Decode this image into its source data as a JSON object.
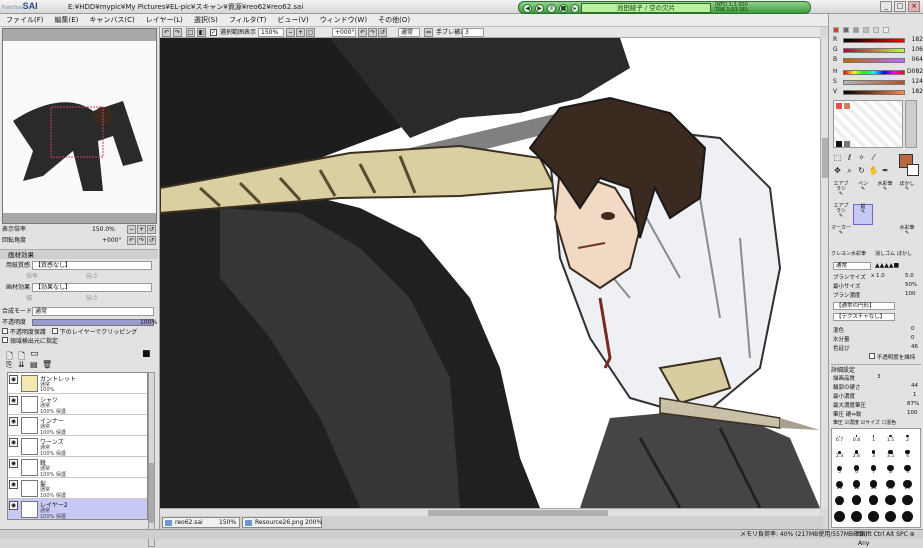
{
  "app": {
    "logo": "SAI",
    "logo_prefix": "PaintTool",
    "title": "E:¥HDD¥mypic¥My Pictures¥EL-pic¥スキャン¥資源¥reo62¥reo62.sai"
  },
  "player": {
    "lcd": "池田綾子 / 空の欠片",
    "info_line1": "INFO 1:3 000",
    "info_line2": "TRK 1:03 SEL"
  },
  "window": {
    "min": "_",
    "max": "□",
    "close": "×"
  },
  "menu": [
    "ファイル(F)",
    "編集(E)",
    "キャンバス(C)",
    "レイヤー(L)",
    "選択(S)",
    "フィルタ(T)",
    "ビュー(V)",
    "ウィンドウ(W)",
    "その他(O)"
  ],
  "navigator": {
    "zoom_label": "表示倍率",
    "zoom_value": "150.0%",
    "angle_label": "回転角度",
    "angle_value": "+000°"
  },
  "paper": {
    "header": "画材効果",
    "texture_label": "用紙質感",
    "texture_value": "【質感なし】",
    "texture_sub1": "倍率",
    "texture_sub2": "強さ",
    "effect_label": "画材効果",
    "effect_value": "【効果なし】",
    "effect_sub1": "幅",
    "effect_sub2": "強さ"
  },
  "layer_props": {
    "blend_label": "合成モード",
    "blend_value": "通常",
    "opacity_label": "不透明度",
    "opacity_value": "100%",
    "protect_label": "不透明度保護",
    "clip_label": "下のレイヤーでクリッピング",
    "select_source_label": "領域検出元に指定"
  },
  "layers": [
    {
      "name": "ガントレット",
      "mode": "通常",
      "opacity": "100%",
      "selected": false
    },
    {
      "name": "シャツ",
      "mode": "通常",
      "opacity": "100% 保護",
      "selected": false
    },
    {
      "name": "インナー",
      "mode": "通常",
      "opacity": "100% 保護",
      "selected": false
    },
    {
      "name": "ワーンズ",
      "mode": "通常",
      "opacity": "100% 保護",
      "selected": false
    },
    {
      "name": "靴",
      "mode": "通常",
      "opacity": "100% 保護",
      "selected": false
    },
    {
      "name": "髪",
      "mode": "通常",
      "opacity": "100% 保護",
      "selected": false
    },
    {
      "name": "レイヤー2",
      "mode": "通常",
      "opacity": "100% 保護",
      "selected": true
    }
  ],
  "canvasbar": {
    "show_selection_label": "選択範囲表示",
    "zoom": "150%",
    "angle": "+000°",
    "mode": "通常",
    "stabilizer_label": "手ブレ補正",
    "stabilizer_value": "3"
  },
  "tabs": [
    {
      "name": "reo62.sai",
      "zoom": "150%"
    },
    {
      "name": "Resource26.png",
      "zoom": "200%"
    }
  ],
  "status": {
    "memory": "メモリ負荷率: 40% (217MB使用/557MB確保)",
    "keys": "Shift Ctrl Alt SPC ⊛ Any"
  },
  "color": {
    "sliders": [
      {
        "label": "R",
        "value": "182"
      },
      {
        "label": "G",
        "value": "106"
      },
      {
        "label": "B",
        "value": "064"
      },
      {
        "label": "H",
        "value": "D082"
      },
      {
        "label": "S",
        "value": "124"
      },
      {
        "label": "V",
        "value": "182"
      }
    ],
    "primary": "#b66a40",
    "secondary": "#ffffff"
  },
  "tools": {
    "brushes": [
      {
        "name": "エアブラシ"
      },
      {
        "name": "ペン"
      },
      {
        "name": "水彩筆"
      },
      {
        "name": "ぼかし"
      },
      {
        "name": "エアブラシ"
      },
      {
        "name": "鉛"
      },
      {
        "name": "マーカー"
      },
      {
        "name": "水彩筆"
      },
      {
        "name": "クレヨン"
      },
      {
        "name": "水彩筆"
      },
      {
        "name": "消しゴム"
      },
      {
        "name": "ぼかし"
      }
    ]
  },
  "brush": {
    "mode": "通常",
    "size_label": "ブラシサイズ",
    "size_mult": "x 1.0",
    "size_value": "5.0",
    "min_label": "最小サイズ",
    "min_value": "50%",
    "density_label": "ブラシ濃度",
    "density_value": "100",
    "shape_value": "【通常の円形】",
    "texture_value": "【テクスチャなし】",
    "mix_label": "混色",
    "mix_value": "0",
    "water_label": "水分量",
    "water_value": "0",
    "blend_label": "色延び",
    "blend_value": "46",
    "keep_opacity_label": "不透明度を維持",
    "detail_header": "詳細設定",
    "quality_label": "描画品質",
    "quality_value": "3",
    "edge_label": "輪郭の硬さ",
    "edge_value": "44",
    "min_density_label": "最小濃度",
    "min_density_value": "1",
    "max_density_label": "最大濃度筆圧",
    "max_density_value": "87%",
    "pressure_label": "筆圧 硬⇔軟",
    "pressure_value": "100",
    "pressure_opts": [
      "筆圧",
      "濃度",
      "サイズ",
      "混色"
    ],
    "presets": [
      "0.7",
      "0.8",
      "1",
      "1.5",
      "2",
      "2.3",
      "2.6",
      "3",
      "3.5",
      "4",
      "5",
      "6",
      "7",
      "8",
      "9",
      "10",
      "12",
      "14",
      "16",
      "20",
      "25",
      "30",
      "35",
      "40",
      "50",
      "60",
      "70",
      "80",
      "100",
      "120"
    ]
  }
}
